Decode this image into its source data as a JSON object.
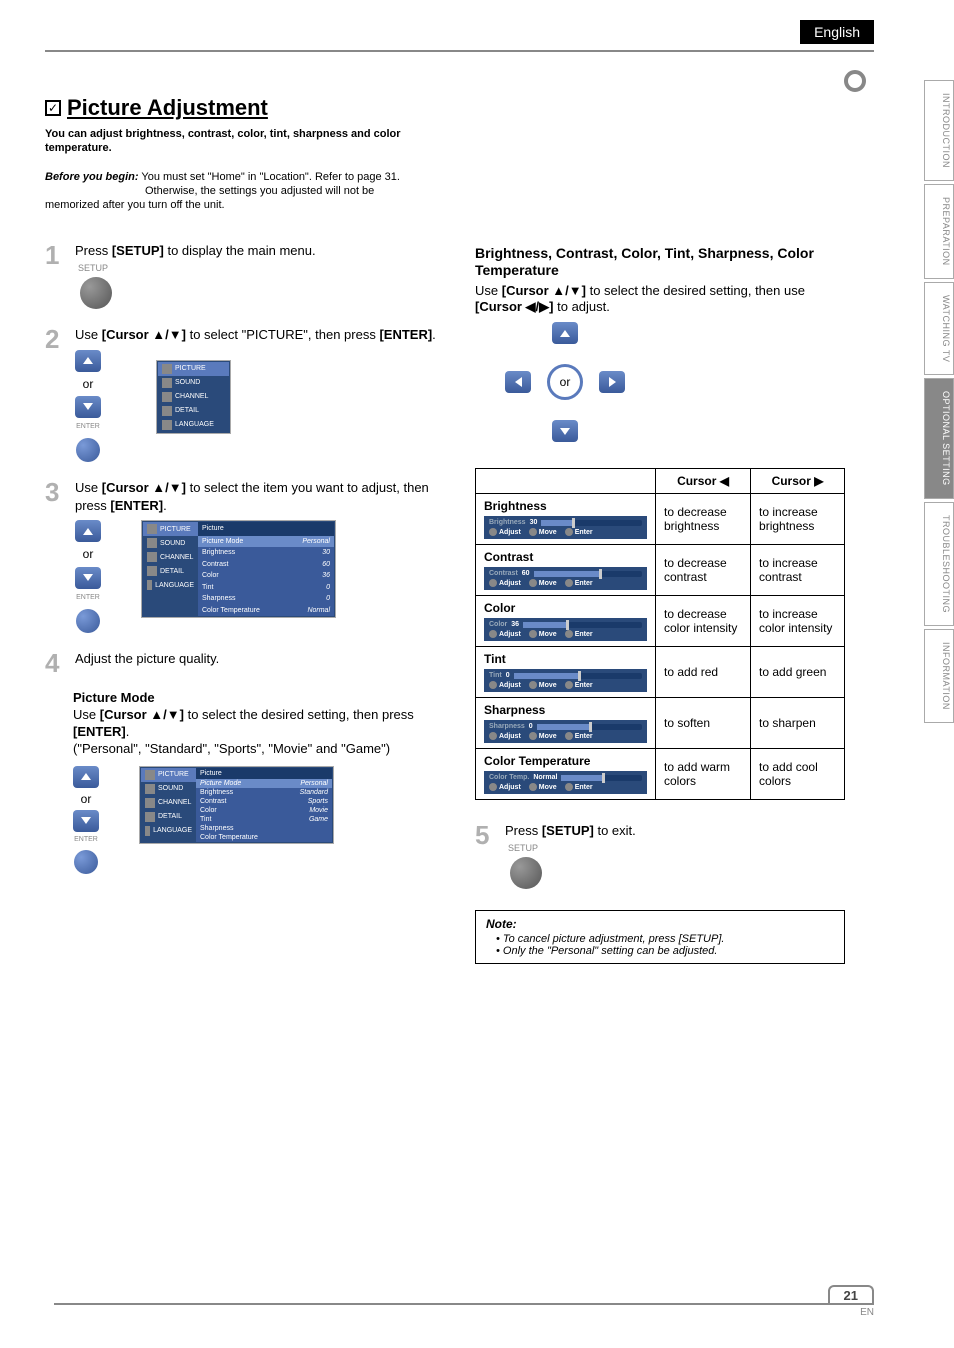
{
  "header": {
    "lang": "English"
  },
  "side_tabs": [
    "INTRODUCTION",
    "PREPARATION",
    "WATCHING TV",
    "OPTIONAL SETTING",
    "TROUBLESHOOTING",
    "INFORMATION"
  ],
  "side_tab_active_index": 3,
  "title": "Picture Adjustment",
  "intro": "You can adjust brightness, contrast, color, tint, sharpness and color temperature.",
  "before_label": "Before you begin:",
  "before_text": "You must set \"Home\" in \"Location\". Refer to page 31.",
  "before_sub": "Otherwise, the settings you adjusted will not be memorized after you turn off the unit.",
  "step1": {
    "text_a": "Press ",
    "text_b": "[SETUP]",
    "text_c": " to display the main menu.",
    "setup_label": "SETUP"
  },
  "step2": {
    "text_a": "Use ",
    "text_b": "[Cursor ▲/▼]",
    "text_c": " to select \"PICTURE\", then press ",
    "text_d": "[ENTER]",
    "text_e": ".",
    "or": "or",
    "menu": [
      "PICTURE",
      "SOUND",
      "CHANNEL",
      "DETAIL",
      "LANGUAGE"
    ],
    "enter_label": "ENTER"
  },
  "step3": {
    "text_a": "Use ",
    "text_b": "[Cursor ▲/▼]",
    "text_c": " to select the item you want to adjust, then press ",
    "text_d": "[ENTER]",
    "text_e": ".",
    "or": "or",
    "enter_label": "ENTER",
    "panel_title": "Picture",
    "panel_items": [
      {
        "l": "Picture Mode",
        "v": "Personal"
      },
      {
        "l": "Brightness",
        "v": "30"
      },
      {
        "l": "Contrast",
        "v": "60"
      },
      {
        "l": "Color",
        "v": "36"
      },
      {
        "l": "Tint",
        "v": "0"
      },
      {
        "l": "Sharpness",
        "v": "0"
      },
      {
        "l": "Color Temperature",
        "v": "Normal"
      }
    ]
  },
  "step4": {
    "text": "Adjust the picture quality.",
    "pm_head": "Picture Mode",
    "pm_a": "Use ",
    "pm_b": "[Cursor ▲/▼]",
    "pm_c": " to select the desired setting, then press ",
    "pm_d": "[ENTER]",
    "pm_e": ".",
    "pm_options": "(\"Personal\", \"Standard\", \"Sports\", \"Movie\" and \"Game\")",
    "or": "or",
    "enter_label": "ENTER",
    "panel_title": "Picture",
    "panel_items": [
      {
        "l": "Picture Mode",
        "v": "Personal"
      },
      {
        "l": "Brightness",
        "v": "Standard"
      },
      {
        "l": "Contrast",
        "v": "Sports"
      },
      {
        "l": "Color",
        "v": "Movie"
      },
      {
        "l": "Tint",
        "v": "Game"
      },
      {
        "l": "Sharpness",
        "v": ""
      },
      {
        "l": "Color Temperature",
        "v": ""
      }
    ]
  },
  "right": {
    "subhead": "Brightness, Contrast, Color, Tint, Sharpness, Color Temperature",
    "sub_a": "Use ",
    "sub_b": "[Cursor ▲/▼]",
    "sub_c": " to select the desired setting, then use ",
    "sub_d": "[Cursor ◀/▶]",
    "sub_e": " to adjust.",
    "or": "or",
    "table": {
      "h_empty": " ",
      "h_left": "Cursor ◀",
      "h_right": "Cursor ▶",
      "rows": [
        {
          "name": "Brightness",
          "slider_label": "Brightness",
          "slider_val": "30",
          "fill": 30,
          "l": "to decrease brightness",
          "r": "to increase brightness"
        },
        {
          "name": "Contrast",
          "slider_label": "Contrast",
          "slider_val": "60",
          "fill": 60,
          "l": "to decrease contrast",
          "r": "to increase contrast"
        },
        {
          "name": "Color",
          "slider_label": "Color",
          "slider_val": "36",
          "fill": 36,
          "l": "to decrease color intensity",
          "r": "to increase color intensity"
        },
        {
          "name": "Tint",
          "slider_label": "Tint",
          "slider_val": "0",
          "fill": 50,
          "l": "to add red",
          "r": "to add green"
        },
        {
          "name": "Sharpness",
          "slider_label": "Sharpness",
          "slider_val": "0",
          "fill": 50,
          "l": "to soften",
          "r": "to sharpen"
        },
        {
          "name": "Color Temperature",
          "slider_label": "Color Temp.",
          "slider_val": "Normal",
          "fill": 50,
          "l": "to add warm colors",
          "r": "to add cool colors"
        }
      ],
      "ctrl_adjust": "Adjust",
      "ctrl_move": "Move",
      "ctrl_enter": "Enter"
    }
  },
  "step5": {
    "text_a": "Press ",
    "text_b": "[SETUP]",
    "text_c": " to exit.",
    "setup_label": "SETUP"
  },
  "note": {
    "head": "Note:",
    "items": [
      "To cancel picture adjustment, press [SETUP].",
      "Only the \"Personal\" setting can be adjusted."
    ]
  },
  "footer": {
    "page": "21",
    "en": "EN"
  }
}
